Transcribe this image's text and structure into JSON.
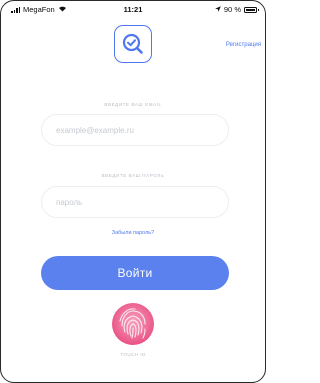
{
  "status_bar": {
    "carrier": "MegaFon",
    "time": "11:21",
    "battery_text": "90 %",
    "icons": [
      "signal-icon",
      "wifi-icon",
      "location-arrow-icon",
      "battery-icon"
    ]
  },
  "header": {
    "logo_icon": "magnifier-check-icon",
    "register_label": "Регистрация"
  },
  "form": {
    "email_label": "ВВЕДИТЕ ВАШ EMAIL",
    "email_placeholder": "example@example.ru",
    "password_label": "ВВЕДИТЕ ВАШ ПАРОЛЬ",
    "password_placeholder": "пароль",
    "forgot_label": "Забыли пароль?",
    "login_label": "Войти"
  },
  "touch_id": {
    "label": "TOUCH ID",
    "icon": "fingerprint-icon"
  },
  "colors": {
    "accent": "#4f78ee",
    "button": "#5b81ee",
    "fingerprint": "#ef5a8c"
  }
}
